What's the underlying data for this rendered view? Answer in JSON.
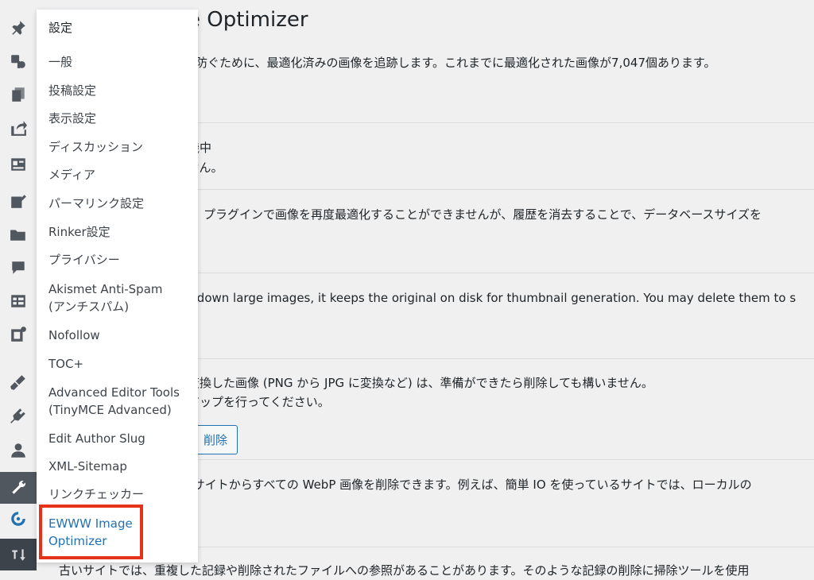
{
  "main": {
    "title": "e Optimizer",
    "line1": "を防ぐために、最適化済みの画像を追跡します。これまでに最適化された画像が7,047個あります。",
    "line2a": "機中",
    "line2b": "ません。",
    "line3": "プラグインで画像を再度最適化することができませんが、履歴を消去することで、データベースサイズを",
    "line4": "es down large images, it keeps the original on disk for thumbnail generation. You may delete them to s",
    "line5a": "変換した画像 (PNG から JPG に変換など) は、準備ができたら削除しても構いません。",
    "line5b": "アップを行ってください。",
    "delete_button": "削除",
    "line6": "Oサイトからすべての WebP 画像を削除できます。例えば、簡単 IO を使っているサイトでは、ローカルの",
    "line7": "古いサイトでは、重複した記録や削除されたファイルへの参照があることがあります。そのような記録の削除に掃除ツールを使用"
  },
  "flyout": {
    "heading": "設定",
    "items": [
      "一般",
      "投稿設定",
      "表示設定",
      "ディスカッション",
      "メディア",
      "パーマリンク設定",
      "Rinker設定",
      "プライバシー",
      "Akismet Anti-Spam",
      "(アンチスパム)",
      "Nofollow",
      "TOC+",
      "Advanced Editor Tools",
      "(TinyMCE Advanced)",
      "Edit Author Slug",
      "XML-Sitemap",
      "リンクチェッカー",
      "EWWW Image",
      "Optimizer"
    ]
  },
  "colors": {
    "accent": "#2271b1",
    "highlight": "#e5331a"
  },
  "icons": [
    "pin-icon",
    "media-icon",
    "pages-icon",
    "share-icon",
    "forms-icon",
    "edit-icon",
    "folder-icon",
    "comments-icon",
    "table-icon",
    "widget-icon",
    "appearance-icon",
    "plugins-icon",
    "users-icon",
    "tools-icon",
    "ewww-icon",
    "sort-icon"
  ]
}
